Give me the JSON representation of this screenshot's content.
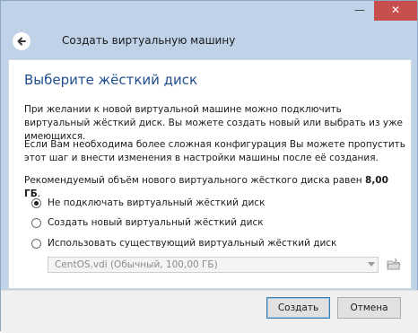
{
  "window": {
    "minimize_glyph": "—",
    "close_glyph": "✕"
  },
  "header": {
    "title": "Создать виртуальную машину",
    "back_icon": "back-arrow-icon"
  },
  "page": {
    "title": "Выберите жёсткий диск",
    "para1": "При желании к новой виртуальной машине можно подключить виртуальный жёсткий диск. Вы можете создать новый или выбрать из уже имеющихся.",
    "para2": "Если Вам необходима более сложная конфигурация Вы можете пропустить этот шаг и внести изменения в настройки машины после её создания.",
    "para3_prefix": "Рекомендуемый объём нового виртуального жёсткого диска равен ",
    "para3_value": "8,00 ГБ",
    "para3_suffix": "."
  },
  "options": [
    {
      "label": "Не подключать виртуальный жёсткий диск",
      "checked": true
    },
    {
      "label": "Создать новый виртуальный жёсткий диск",
      "checked": false
    },
    {
      "label": "Использовать существующий виртуальный жёсткий диск",
      "checked": false
    }
  ],
  "disk_select": {
    "value": "CentOS.vdi (Обычный, 100,00 ГБ)",
    "enabled": false
  },
  "buttons": {
    "create": "Создать",
    "cancel": "Отмена"
  },
  "colors": {
    "accent": "#1f4e8f",
    "close_button": "#c7504f",
    "window_frame": "#bfd2e8"
  }
}
